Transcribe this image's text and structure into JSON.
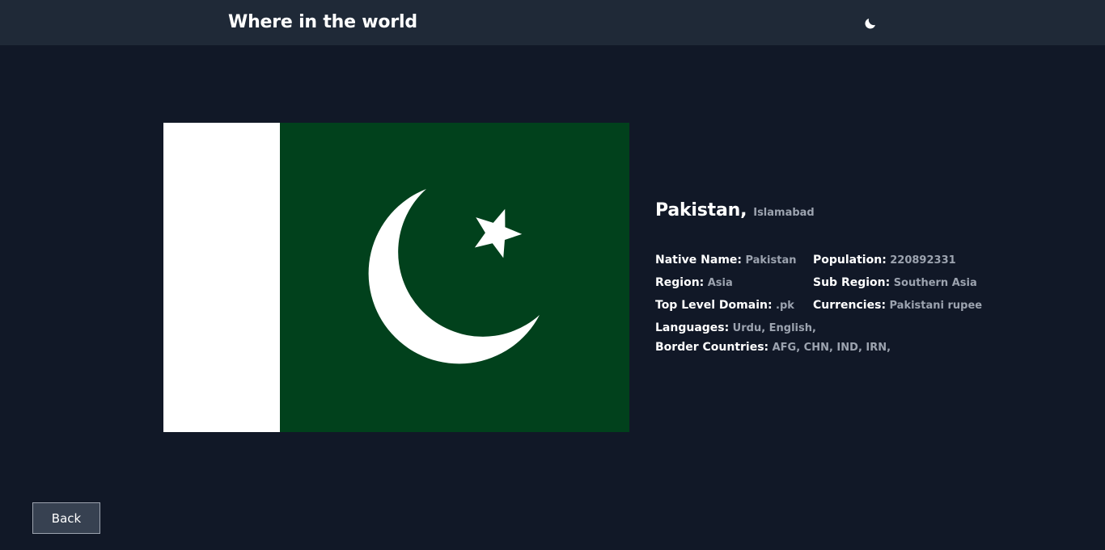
{
  "header": {
    "title": "Where in the world",
    "theme_icon": "moon-icon"
  },
  "flag": {
    "country": "Pakistan",
    "colors": {
      "field": "#01411c",
      "hoist": "#ffffff",
      "emblem": "#ffffff"
    }
  },
  "country": {
    "name": "Pakistan,",
    "capital": "Islamabad",
    "native_name_label": "Native Name:",
    "native_name": "Pakistan",
    "population_label": "Population:",
    "population": "220892331",
    "region_label": "Region:",
    "region": "Asia",
    "sub_region_label": "Sub Region:",
    "sub_region": "Southern Asia",
    "tld_label": "Top Level Domain:",
    "tld": ".pk",
    "currencies_label": "Currencies:",
    "currencies": "Pakistani rupee",
    "languages_label": "Languages:",
    "languages": "Urdu, English,",
    "borders_label": "Border Countries:",
    "borders": "AFG, CHN, IND, IRN,"
  },
  "back_button": {
    "label": "Back"
  }
}
